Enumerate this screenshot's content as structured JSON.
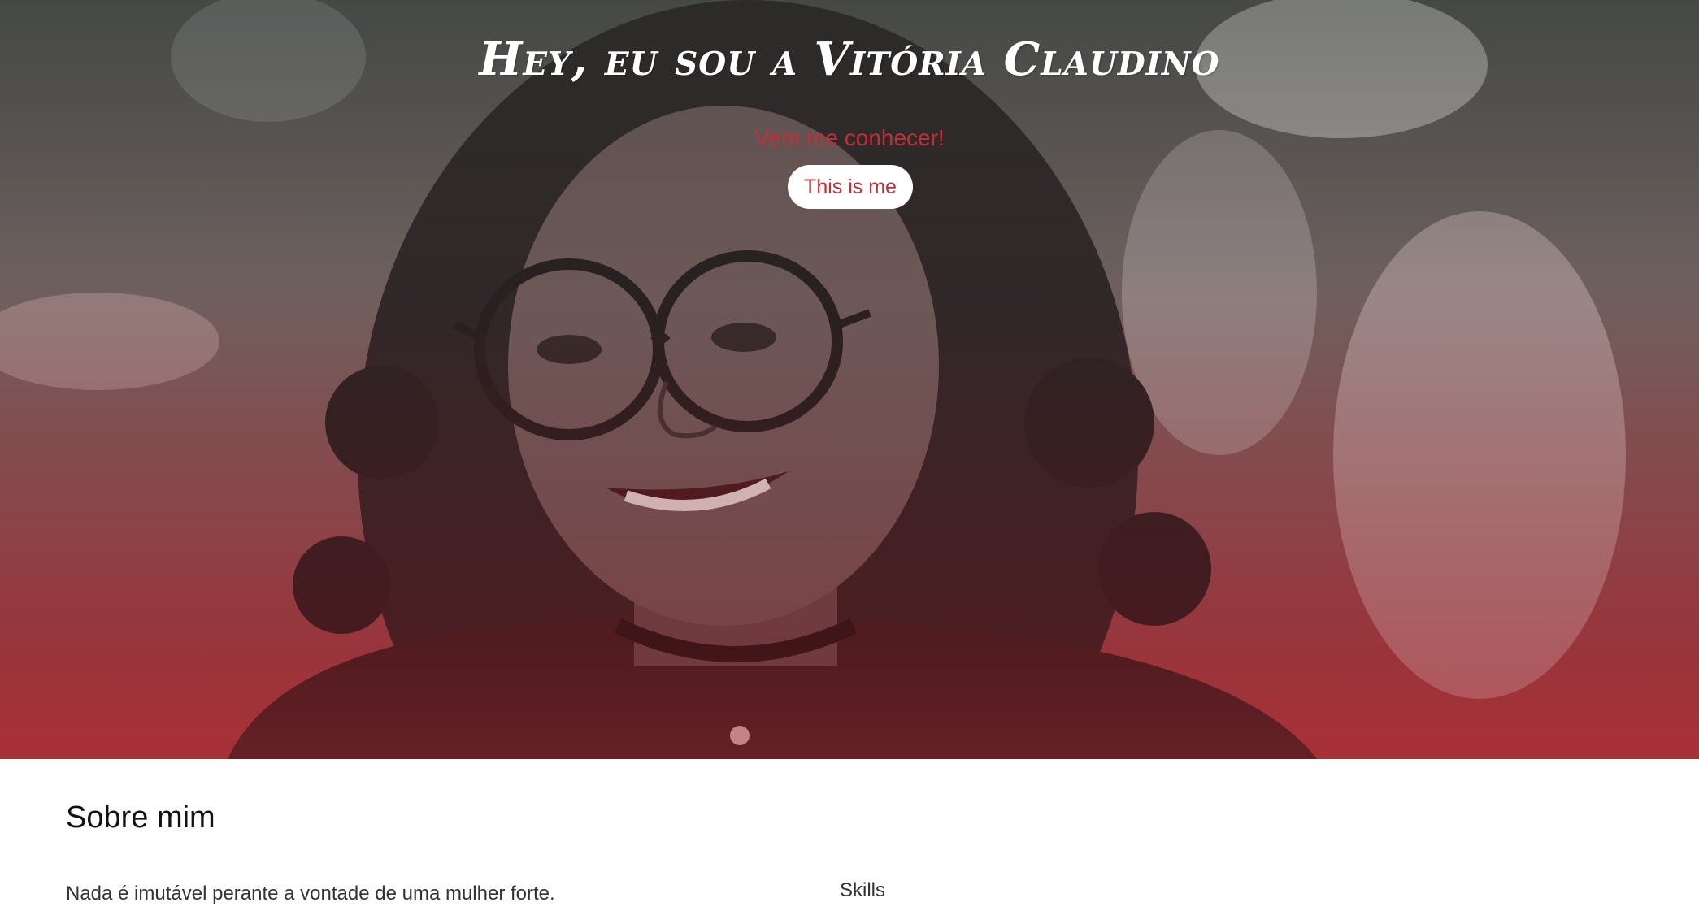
{
  "hero": {
    "title": "Hey, eu sou a Vitória Claudino",
    "subtitle": "Vem me conhecer!",
    "button_label": "This is me"
  },
  "about": {
    "title": "Sobre mim",
    "text": "Nada é imutável perante a vontade de uma mulher forte.",
    "skills_label": "Skills"
  },
  "colors": {
    "accent": "#c0303a",
    "hero_gradient_bottom": "#a8373d",
    "text_dark": "#111111"
  }
}
